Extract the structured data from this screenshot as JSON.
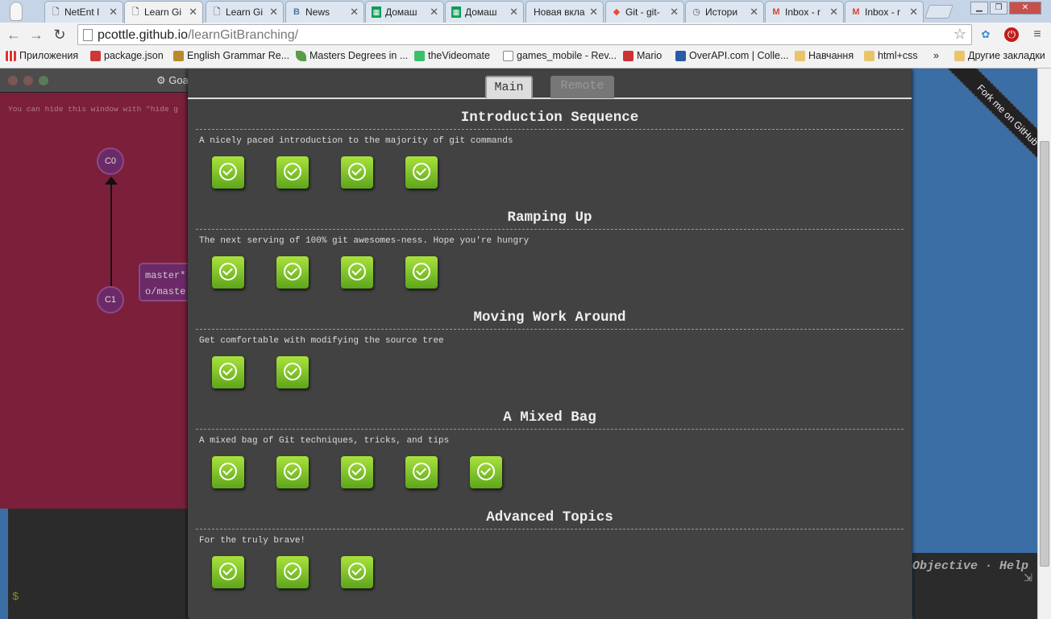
{
  "browser": {
    "tabs": [
      {
        "title": "NetEnt I",
        "icon": "page-icon"
      },
      {
        "title": "Learn Gi",
        "icon": "page-icon",
        "active": true
      },
      {
        "title": "Learn Gi",
        "icon": "page-icon"
      },
      {
        "title": "News",
        "icon": "vk-icon"
      },
      {
        "title": "Домаш",
        "icon": "sheets-icon"
      },
      {
        "title": "Домаш",
        "icon": "sheets-icon"
      },
      {
        "title": "Новая вкла",
        "icon": "none"
      },
      {
        "title": "Git - git-",
        "icon": "git-icon"
      },
      {
        "title": "Истори",
        "icon": "history-icon"
      },
      {
        "title": "Inbox - r",
        "icon": "gmail-icon"
      },
      {
        "title": "Inbox - r",
        "icon": "gmail-icon"
      }
    ],
    "url_host": "pcottle.github.io",
    "url_path": "/learnGitBranching/",
    "bookmarks": [
      {
        "label": "Приложения",
        "icon": "apps-grid-icon"
      },
      {
        "label": "package.json",
        "icon": "npm-icon"
      },
      {
        "label": "English Grammar Re...",
        "icon": "book-icon"
      },
      {
        "label": "Masters Degrees in ...",
        "icon": "leaf-icon"
      },
      {
        "label": "theVideomate",
        "icon": "download-icon"
      },
      {
        "label": "games_mobile - Rev...",
        "icon": "page-icon"
      },
      {
        "label": "Mario",
        "icon": "mario-icon"
      },
      {
        "label": "OverAPI.com | Colle...",
        "icon": "overapi-icon"
      },
      {
        "label": "Навчання",
        "icon": "folder-icon"
      },
      {
        "label": "html+css",
        "icon": "folder-icon"
      }
    ],
    "bookmarks_more": "»",
    "other_bookmarks": "Другие закладки"
  },
  "goal_window": {
    "title": "Goa",
    "hint": "You can hide this window with \"hide g",
    "commits": [
      "C0",
      "C1"
    ],
    "branch_label_lines": [
      "master*",
      "o/maste"
    ]
  },
  "terminal": {
    "prompt": "$"
  },
  "helper": {
    "objective_help": "Objective · Help"
  },
  "ribbon": {
    "text": "Fork me on GitHub"
  },
  "level_dialog": {
    "tabs": {
      "main": "Main",
      "remote": "Remote"
    },
    "sequences": [
      {
        "title": "Introduction Sequence",
        "description": "A nicely paced introduction to the majority of git commands",
        "levels_completed": 4
      },
      {
        "title": "Ramping Up",
        "description": "The next serving of 100% git awesomes-ness. Hope you're hungry",
        "levels_completed": 4
      },
      {
        "title": "Moving Work Around",
        "description": "Get comfortable with modifying the source tree",
        "levels_completed": 2
      },
      {
        "title": "A Mixed Bag",
        "description": "A mixed bag of Git techniques, tricks, and tips",
        "levels_completed": 5
      },
      {
        "title": "Advanced Topics",
        "description": "For the truly brave!",
        "levels_completed": 3
      }
    ]
  },
  "colors": {
    "accent_level": "#7bc428",
    "dialog_bg": "#424242",
    "goal_bg": "#7c1f3b",
    "page_bg": "#3b6ea5"
  }
}
